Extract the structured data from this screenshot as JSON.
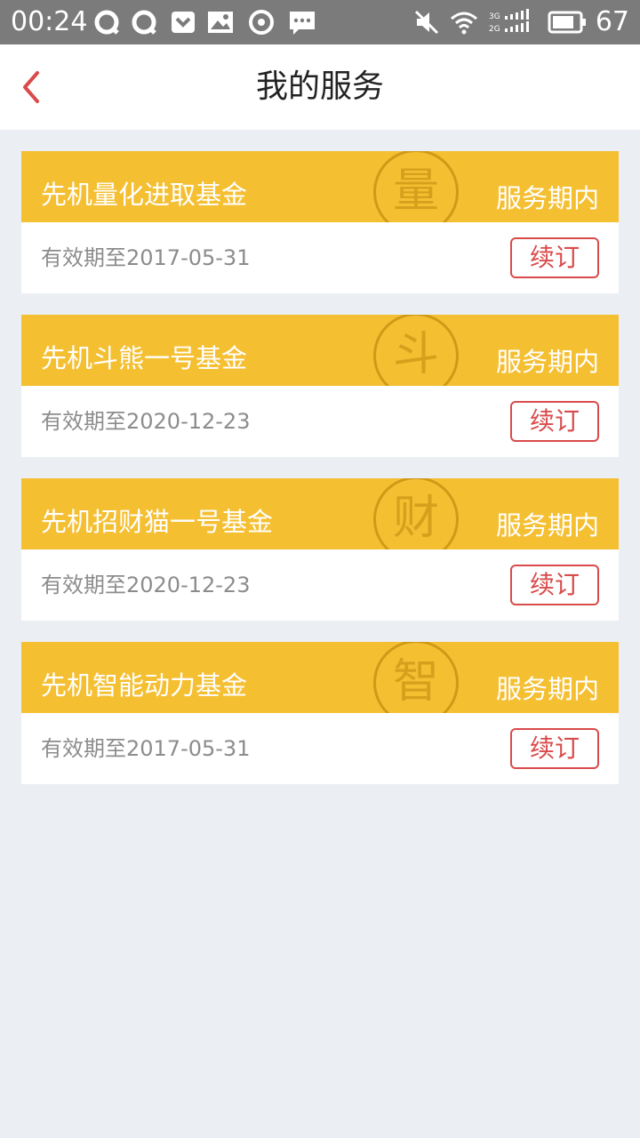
{
  "status_bar": {
    "time": "00:24",
    "battery": "67",
    "icons": [
      "qq-icon",
      "qq-icon",
      "pocket-icon",
      "image-icon",
      "target-icon",
      "message-icon",
      "mute-icon",
      "wifi-icon",
      "signal-icon",
      "battery-icon"
    ]
  },
  "header": {
    "title": "我的服务",
    "back_icon": "chevron-left-icon"
  },
  "colors": {
    "card_top": "#f5bf32",
    "accent_red": "#d94b4b",
    "background": "#ebeef3"
  },
  "cards": [
    {
      "name": "先机量化进取基金",
      "seal": "量",
      "status": "服务期内",
      "valid_until": "有效期至2017-05-31",
      "renew_label": "续订"
    },
    {
      "name": "先机斗熊一号基金",
      "seal": "斗",
      "status": "服务期内",
      "valid_until": "有效期至2020-12-23",
      "renew_label": "续订"
    },
    {
      "name": "先机招财猫一号基金",
      "seal": "财",
      "status": "服务期内",
      "valid_until": "有效期至2020-12-23",
      "renew_label": "续订"
    },
    {
      "name": "先机智能动力基金",
      "seal": "智",
      "status": "服务期内",
      "valid_until": "有效期至2017-05-31",
      "renew_label": "续订"
    }
  ]
}
